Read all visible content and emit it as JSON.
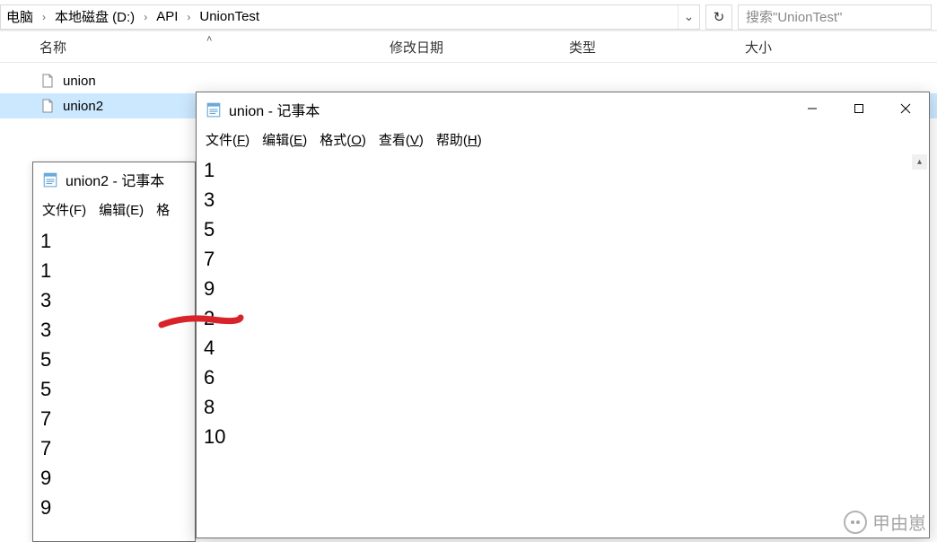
{
  "explorer": {
    "breadcrumb": [
      {
        "label": "电脑"
      },
      {
        "label": "本地磁盘 (D:)"
      },
      {
        "label": "API"
      },
      {
        "label": "UnionTest"
      }
    ],
    "search_placeholder": "搜索\"UnionTest\"",
    "columns": {
      "name": "名称",
      "modified": "修改日期",
      "type": "类型",
      "size": "大小"
    },
    "files": [
      {
        "name": "union",
        "selected": false
      },
      {
        "name": "union2",
        "selected": true
      }
    ]
  },
  "notepad_back": {
    "title": "union2 - 记事本",
    "menu": [
      "文件(F)",
      "编辑(E)",
      "格"
    ],
    "lines": [
      "1",
      "1",
      "3",
      "3",
      "5",
      "5",
      "7",
      "7",
      "9",
      "9"
    ]
  },
  "notepad_front": {
    "title": "union - 记事本",
    "menu": [
      "文件(F)",
      "编辑(E)",
      "格式(O)",
      "查看(V)",
      "帮助(H)"
    ],
    "lines": [
      "1",
      "3",
      "5",
      "7",
      "9",
      "2",
      "4",
      "6",
      "8",
      "10"
    ]
  },
  "watermark": "甲由崽"
}
